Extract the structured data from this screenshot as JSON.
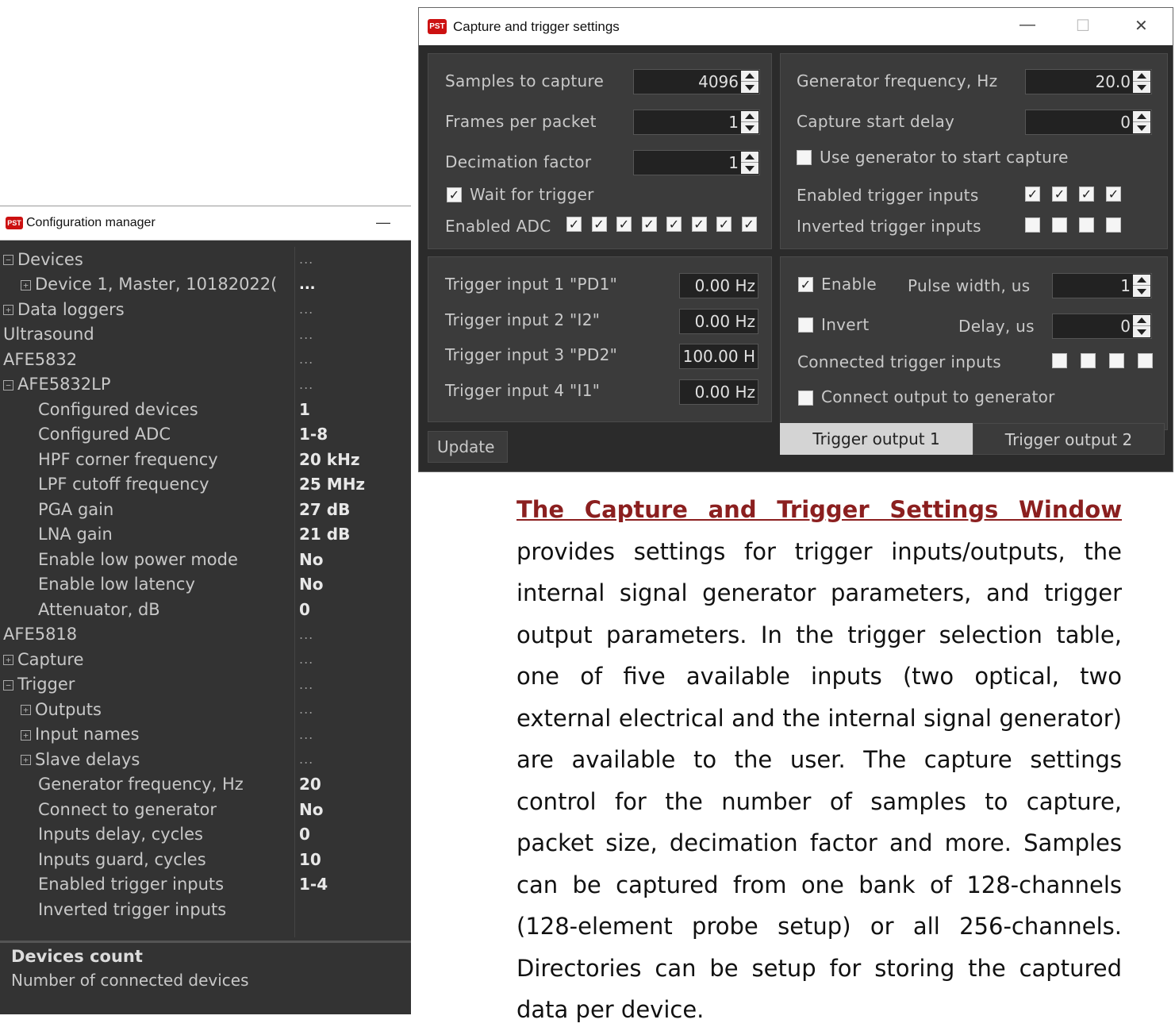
{
  "config_manager": {
    "window_title": "Configuration manager",
    "icon_text": "PST",
    "rows": [
      {
        "name": "Devices",
        "value": "...",
        "indent": 0,
        "expander": "⊟",
        "val_style": "dots"
      },
      {
        "name": "Device 1, Master, 10182022(",
        "value": "...",
        "indent": 1,
        "expander": "⊞",
        "val_style": "dotsb"
      },
      {
        "name": "Data loggers",
        "value": "...",
        "indent": 0,
        "expander": "⊞",
        "val_style": "dots"
      },
      {
        "name": "Ultrasound",
        "value": "...",
        "indent": 0,
        "expander": "",
        "val_style": "dots"
      },
      {
        "name": "AFE5832",
        "value": "...",
        "indent": 0,
        "expander": "",
        "val_style": "dots"
      },
      {
        "name": "AFE5832LP",
        "value": "...",
        "indent": 0,
        "expander": "⊟",
        "val_style": "dots"
      },
      {
        "name": "Configured devices",
        "value": "1",
        "indent": 2,
        "expander": "",
        "val_style": "bold"
      },
      {
        "name": "Configured ADC",
        "value": "1-8",
        "indent": 2,
        "expander": "",
        "val_style": "bold"
      },
      {
        "name": "HPF corner frequency",
        "value": "20 kHz",
        "indent": 2,
        "expander": "",
        "val_style": "bold"
      },
      {
        "name": "LPF cutoff frequency",
        "value": "25 MHz",
        "indent": 2,
        "expander": "",
        "val_style": "bold"
      },
      {
        "name": "PGA gain",
        "value": "27 dB",
        "indent": 2,
        "expander": "",
        "val_style": "bold"
      },
      {
        "name": "LNA gain",
        "value": "21 dB",
        "indent": 2,
        "expander": "",
        "val_style": "bold"
      },
      {
        "name": "Enable low power mode",
        "value": "No",
        "indent": 2,
        "expander": "",
        "val_style": "bold"
      },
      {
        "name": "Enable low latency",
        "value": "No",
        "indent": 2,
        "expander": "",
        "val_style": "bold"
      },
      {
        "name": "Attenuator, dB",
        "value": "0",
        "indent": 2,
        "expander": "",
        "val_style": "bold"
      },
      {
        "name": "AFE5818",
        "value": "...",
        "indent": 0,
        "expander": "",
        "val_style": "dots"
      },
      {
        "name": "Capture",
        "value": "...",
        "indent": 0,
        "expander": "⊞",
        "val_style": "dots"
      },
      {
        "name": "Trigger",
        "value": "...",
        "indent": 0,
        "expander": "⊟",
        "val_style": "dots"
      },
      {
        "name": "Outputs",
        "value": "...",
        "indent": 1,
        "expander": "⊞",
        "val_style": "dots"
      },
      {
        "name": "Input names",
        "value": "...",
        "indent": 1,
        "expander": "⊞",
        "val_style": "dots"
      },
      {
        "name": "Slave delays",
        "value": "...",
        "indent": 1,
        "expander": "⊞",
        "val_style": "dots"
      },
      {
        "name": "Generator frequency, Hz",
        "value": "20",
        "indent": 2,
        "expander": "",
        "val_style": "bold"
      },
      {
        "name": "Connect to generator",
        "value": "No",
        "indent": 2,
        "expander": "",
        "val_style": "bold"
      },
      {
        "name": "Inputs delay, cycles",
        "value": "0",
        "indent": 2,
        "expander": "",
        "val_style": "bold"
      },
      {
        "name": "Inputs guard, cycles",
        "value": "10",
        "indent": 2,
        "expander": "",
        "val_style": "bold"
      },
      {
        "name": "Enabled trigger inputs",
        "value": "1-4",
        "indent": 2,
        "expander": "",
        "val_style": "bold"
      },
      {
        "name": "Inverted trigger inputs",
        "value": "",
        "indent": 2,
        "expander": "",
        "val_style": "bold"
      }
    ],
    "description_title": "Devices count",
    "description_text": "Number of connected devices"
  },
  "capture_window": {
    "window_title": "Capture and trigger settings",
    "icon_text": "PST",
    "min_label": "—",
    "max_label": "☐",
    "close_label": "✕",
    "samples_label": "Samples to capture",
    "samples_value": "4096",
    "frames_label": "Frames per packet",
    "frames_value": "1",
    "decimation_label": "Decimation factor",
    "decimation_value": "1",
    "wait_trigger_label": "Wait for trigger",
    "wait_trigger_checked": true,
    "enabled_adc_label": "Enabled ADC",
    "enabled_adc": [
      true,
      true,
      true,
      true,
      true,
      true,
      true,
      true
    ],
    "gen_freq_label": "Generator frequency, Hz",
    "gen_freq_value": "20.0",
    "start_delay_label": "Capture start delay",
    "start_delay_value": "0",
    "use_gen_label": "Use generator to start capture",
    "use_gen_checked": false,
    "enabled_trig_label": "Enabled trigger inputs",
    "enabled_trig": [
      true,
      true,
      true,
      true
    ],
    "inverted_trig_label": "Inverted trigger inputs",
    "inverted_trig": [
      false,
      false,
      false,
      false
    ],
    "trigger_inputs": [
      {
        "label": "Trigger input 1 \"PD1\"",
        "value": "0.00 Hz"
      },
      {
        "label": "Trigger input 2 \"I2\"",
        "value": "0.00 Hz"
      },
      {
        "label": "Trigger input 3 \"PD2\"",
        "value": "100.00 H"
      },
      {
        "label": "Trigger input 4 \"I1\"",
        "value": "0.00 Hz"
      }
    ],
    "enable_label": "Enable",
    "enable_checked": true,
    "pulse_width_label": "Pulse width, us",
    "pulse_width_value": "1",
    "invert_label": "Invert",
    "invert_checked": false,
    "delay_label": "Delay, us",
    "delay_value": "0",
    "connected_trig_label": "Connected trigger inputs",
    "connected_trig": [
      false,
      false,
      false,
      false
    ],
    "connect_gen_label": "Connect output to generator",
    "connect_gen_checked": false,
    "update_label": "Update",
    "tabs": [
      "Trigger output 1",
      "Trigger output 2"
    ],
    "active_tab": 0
  },
  "document": {
    "heading": "The   Capture and Trigger Settings Window",
    "body": " provides settings for trigger inputs/outputs, the internal signal generator parameters, and trigger output parameters.  In the trigger selection table, one of five available inputs (two optical, two external electrical and the internal signal generator) are available to the user.  The capture settings control  for the number of samples to capture, packet size, decimation factor and more. Samples can be captured from one bank of 128-channels (128-element probe setup) or all 256-channels. Directories can be setup for storing the captured data per device."
  }
}
